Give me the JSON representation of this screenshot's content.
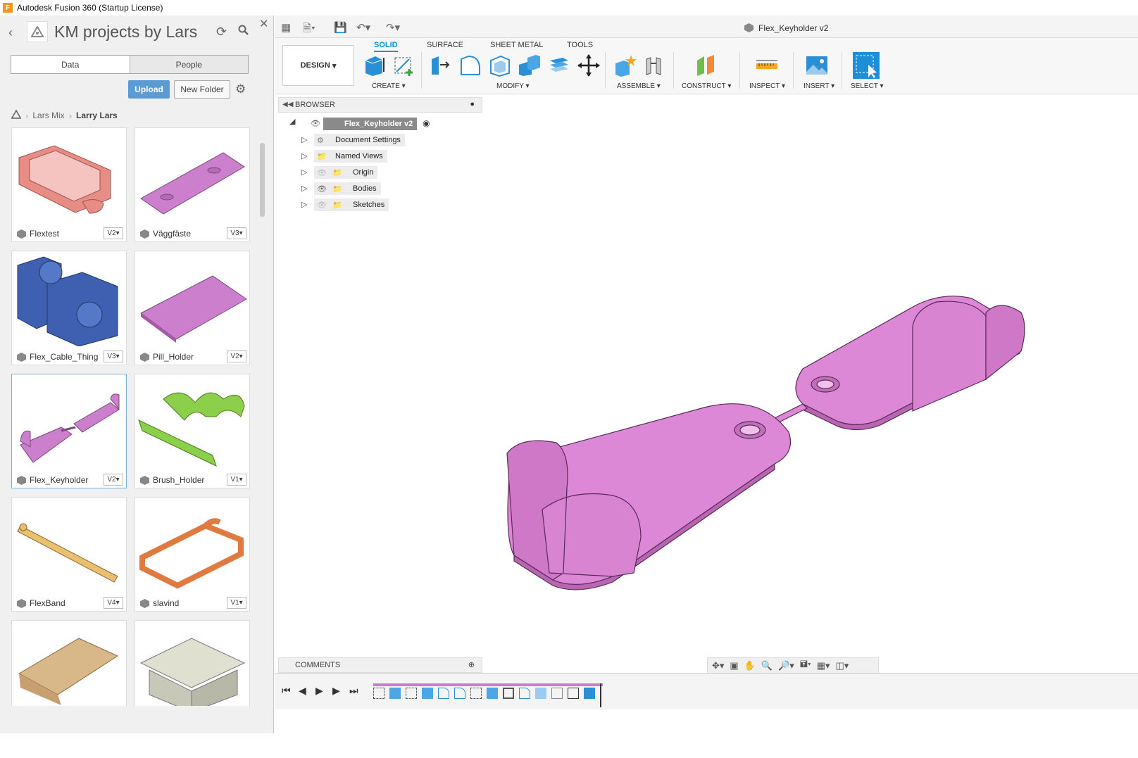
{
  "window": {
    "title": "Autodesk Fusion 360 (Startup License)"
  },
  "data_panel": {
    "title": "KM projects by Lars",
    "tabs": [
      "Data",
      "People"
    ],
    "upload_label": "Upload",
    "new_folder_label": "New Folder",
    "breadcrumb": [
      "Lars Mix",
      "Larry Lars"
    ],
    "items": [
      {
        "name": "Flextest",
        "version": "V2",
        "color": "#e88c86"
      },
      {
        "name": "Väggfäste",
        "version": "V3",
        "color": "#cc7fcc"
      },
      {
        "name": "Flex_Cable_Thing",
        "version": "V3",
        "color": "#3f5fb0"
      },
      {
        "name": "Pill_Holder",
        "version": "V2",
        "color": "#cc7fcc"
      },
      {
        "name": "Flex_Keyholder",
        "version": "V2",
        "color": "#cc7fcc"
      },
      {
        "name": "Brush_Holder",
        "version": "V1",
        "color": "#8ccf4a"
      },
      {
        "name": "FlexBand",
        "version": "V4",
        "color": "#e8c070"
      },
      {
        "name": "slavind",
        "version": "V1",
        "color": "#e07a40"
      },
      {
        "name": "",
        "version": "",
        "color": "#d8b888"
      },
      {
        "name": "",
        "version": "",
        "color": "#c8c8b8"
      }
    ]
  },
  "toolbar": {
    "document_title": "Flex_Keyholder v2",
    "design_label": "DESIGN",
    "tabs": [
      "SOLID",
      "SURFACE",
      "SHEET METAL",
      "TOOLS"
    ],
    "groups": [
      "CREATE",
      "MODIFY",
      "ASSEMBLE",
      "CONSTRUCT",
      "INSPECT",
      "INSERT",
      "SELECT"
    ]
  },
  "browser": {
    "title": "BROWSER",
    "root": "Flex_Keyholder v2",
    "nodes": [
      "Document Settings",
      "Named Views",
      "Origin",
      "Bodies",
      "Sketches"
    ]
  },
  "comments_label": "COMMENTS",
  "model_color": "#dd88d6"
}
